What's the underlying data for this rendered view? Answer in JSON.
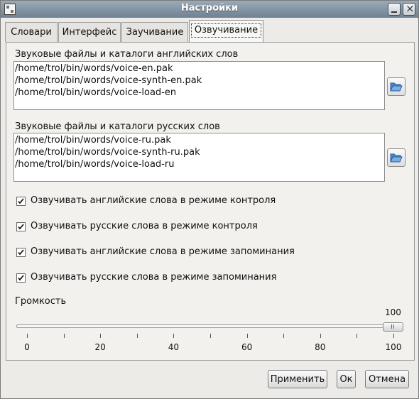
{
  "window": {
    "title": "Настройки"
  },
  "tabs": [
    {
      "label": "Словари"
    },
    {
      "label": "Интерфейс"
    },
    {
      "label": "Заучивание"
    },
    {
      "label": "Озвучивание",
      "active": true
    }
  ],
  "english_sounds": {
    "label": "Звуковые файлы и каталоги английских слов",
    "items": [
      "/home/trol/bin/words/voice-en.pak",
      "/home/trol/bin/words/voice-synth-en.pak",
      "/home/trol/bin/words/voice-load-en"
    ]
  },
  "russian_sounds": {
    "label": "Звуковые файлы и каталоги русских слов",
    "items": [
      "/home/trol/bin/words/voice-ru.pak",
      "/home/trol/bin/words/voice-synth-ru.pak",
      "/home/trol/bin/words/voice-load-ru"
    ]
  },
  "options": [
    {
      "label": "Озвучивать английские слова в режиме контроля",
      "checked": true
    },
    {
      "label": "Озвучивать русские слова в режиме контроля",
      "checked": true
    },
    {
      "label": "Озвучивать английские слова в режиме запоминания",
      "checked": true
    },
    {
      "label": "Озвучивать русские слова в режиме запоминания",
      "checked": true
    }
  ],
  "volume": {
    "label": "Громкость",
    "value": 100,
    "value_text": "100",
    "min": 0,
    "max": 100,
    "ticks": [
      "0",
      "20",
      "40",
      "60",
      "80",
      "100"
    ]
  },
  "buttons": {
    "apply": "Применить",
    "ok": "Ок",
    "cancel": "Отмена"
  },
  "icons": {
    "title": "window-icon",
    "folder": "open-folder-icon",
    "check": "checkmark-icon"
  }
}
